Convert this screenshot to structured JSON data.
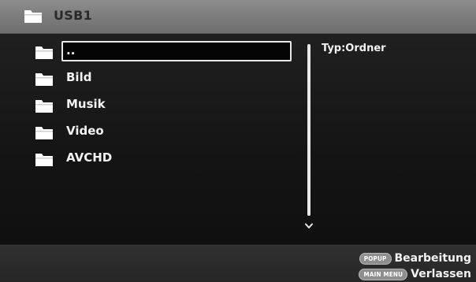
{
  "header": {
    "icon": "folder-icon",
    "title": "USB1"
  },
  "file_list": {
    "items": [
      {
        "label": "..",
        "icon": "folder-icon",
        "selected": true
      },
      {
        "label": "Bild",
        "icon": "folder-icon",
        "selected": false
      },
      {
        "label": "Musik",
        "icon": "folder-icon",
        "selected": false
      },
      {
        "label": "Video",
        "icon": "folder-icon",
        "selected": false
      },
      {
        "label": "AVCHD",
        "icon": "folder-icon",
        "selected": false
      }
    ]
  },
  "info": {
    "type_text": "Typ:Ordner"
  },
  "scrollbar": {
    "icon": "chevron-down-icon"
  },
  "footer": {
    "actions": [
      {
        "key": "POPUP",
        "label": "Bearbeitung"
      },
      {
        "key": "MAIN MENU",
        "label": "Verlassen"
      }
    ]
  },
  "colors": {
    "header_bg": "#7f7f7f",
    "header_text": "#2a2a2a",
    "text": "#f2f2f2",
    "focus_border": "#e8e8e8",
    "key_badge": "#8e8e8e"
  }
}
